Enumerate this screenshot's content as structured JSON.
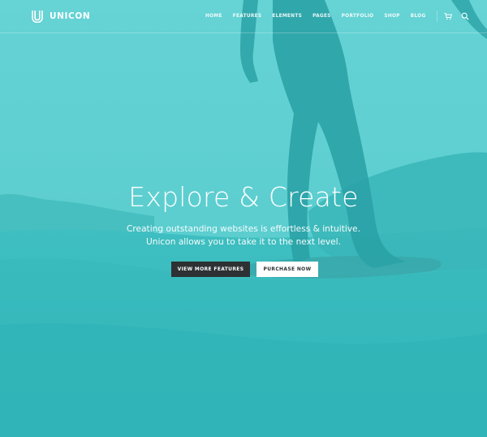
{
  "brand": {
    "name": "UNICON",
    "logo_icon": "u-logo-icon"
  },
  "nav": {
    "items": [
      "HOME",
      "FEATURES",
      "ELEMENTS",
      "PAGES",
      "PORTFOLIO",
      "SHOP",
      "BLOG"
    ],
    "icons": [
      "cart-icon",
      "search-icon"
    ]
  },
  "hero": {
    "title": "Explore & Create",
    "subtitle_line1": "Creating outstanding websites is effortless & intuitive.",
    "subtitle_line2": "Unicon allows you to take it to the next level.",
    "primary_button": "VIEW MORE FEATURES",
    "secondary_button": "PURCHASE NOW"
  },
  "colors": {
    "overlay": "#4ec6c8",
    "dark_button": "#2d3133",
    "light_button": "#ffffff",
    "text": "#ffffff"
  }
}
